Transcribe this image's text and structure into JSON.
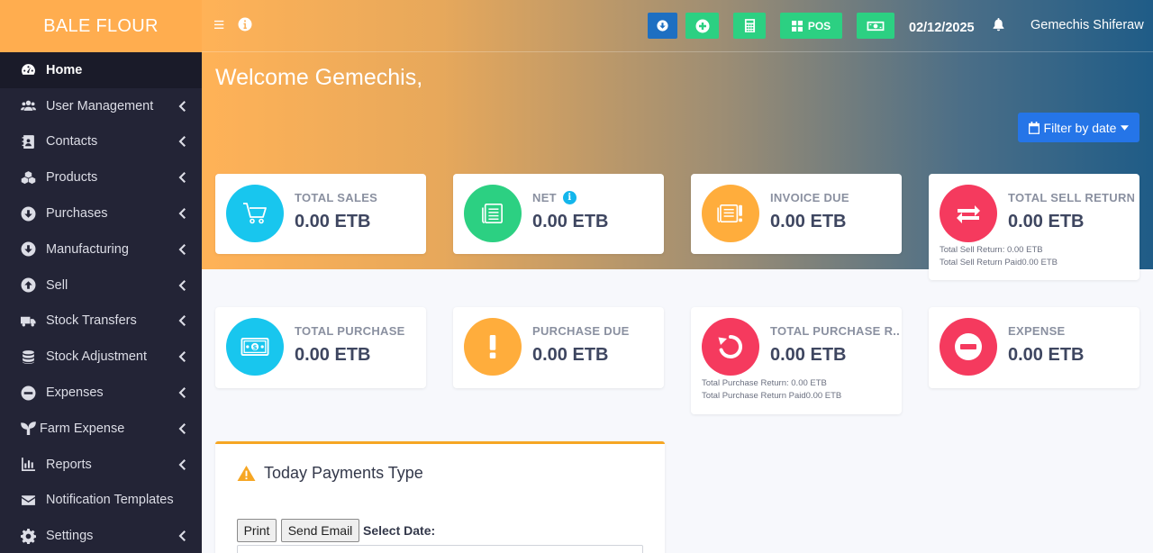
{
  "brand": {
    "name": "BALE FLOUR",
    "color": "#ffad4f"
  },
  "sidebar": {
    "items": [
      {
        "label": "Home",
        "icon": "dashboard-icon",
        "active": true
      },
      {
        "label": "User Management",
        "icon": "users-icon"
      },
      {
        "label": "Contacts",
        "icon": "address-book-icon"
      },
      {
        "label": "Products",
        "icon": "cubes-icon"
      },
      {
        "label": "Purchases",
        "icon": "arrow-circle-down-icon"
      },
      {
        "label": "Manufacturing",
        "icon": "arrow-circle-down-icon"
      },
      {
        "label": "Sell",
        "icon": "arrow-circle-up-icon"
      },
      {
        "label": "Stock Transfers",
        "icon": "truck-icon"
      },
      {
        "label": "Stock Adjustment",
        "icon": "database-icon"
      },
      {
        "label": "Expenses",
        "icon": "minus-circle-icon"
      },
      {
        "label": "Farm Expense",
        "icon": "seedling-icon"
      },
      {
        "label": "Reports",
        "icon": "bar-chart-icon"
      },
      {
        "label": "Notification Templates",
        "icon": "envelope-icon"
      },
      {
        "label": "Settings",
        "icon": "gear-icon"
      }
    ]
  },
  "topbar": {
    "pos_label": "POS",
    "date": "02/12/2025",
    "user": "Gemechis Shiferaw",
    "buttons_colors": {
      "download": "#1d6fc2",
      "add": "#2cd082",
      "calculator": "#2cd082",
      "pos": "#2cd082",
      "money": "#2cd082"
    }
  },
  "welcome": "Welcome Gemechis,",
  "filter": {
    "label": "Filter by date"
  },
  "cards": {
    "total_sales": {
      "title": "TOTAL SALES",
      "value": "0.00 ETB"
    },
    "net": {
      "title": "NET",
      "value": "0.00 ETB"
    },
    "invoice_due": {
      "title": "INVOICE DUE",
      "value": "0.00 ETB"
    },
    "total_sell_return": {
      "title": "TOTAL SELL RETURN",
      "value": "0.00 ETB",
      "sub1": "Total Sell Return: 0.00 ETB",
      "sub2": "Total Sell Return Paid0.00 ETB"
    },
    "total_purchase": {
      "title": "TOTAL PURCHASE",
      "value": "0.00 ETB"
    },
    "purchase_due": {
      "title": "PURCHASE DUE",
      "value": "0.00 ETB"
    },
    "total_purchase_return": {
      "title": "TOTAL PURCHASE R...",
      "value": "0.00 ETB",
      "sub1": "Total Purchase Return: 0.00 ETB",
      "sub2": "Total Purchase Return Paid0.00 ETB"
    },
    "expense": {
      "title": "EXPENSE",
      "value": "0.00 ETB"
    }
  },
  "payments_panel": {
    "title": "Today Payments Type",
    "print_label": "Print",
    "send_email_label": "Send Email",
    "select_date_label": "Select Date:"
  }
}
